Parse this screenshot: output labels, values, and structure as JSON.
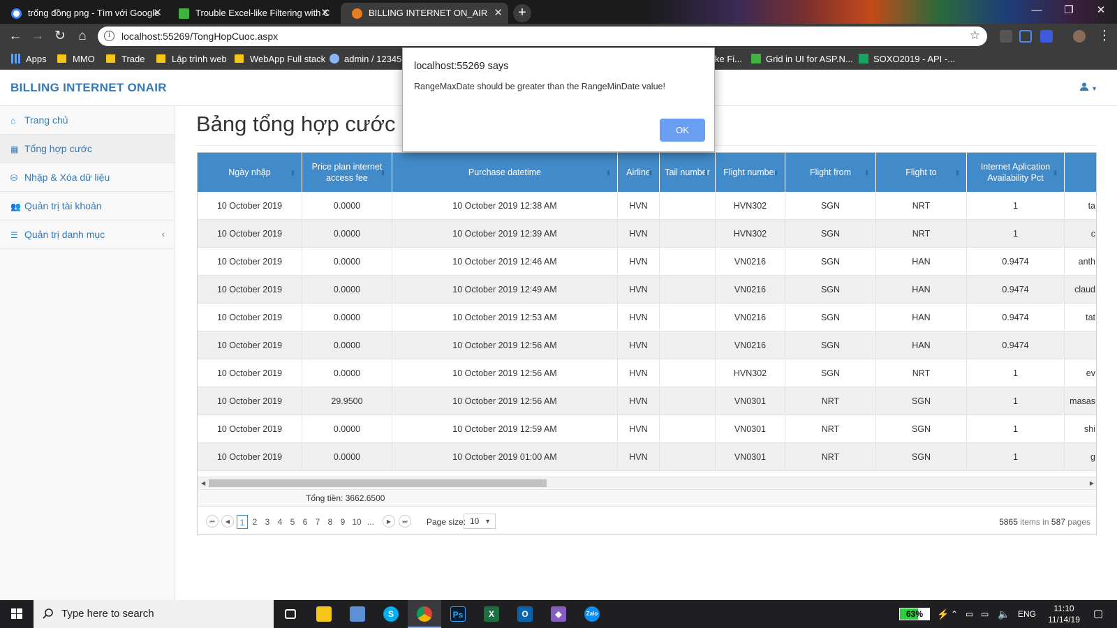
{
  "browser": {
    "tabs": [
      {
        "title": "trống đồng png - Tìm với Google",
        "active": false
      },
      {
        "title": "Trouble Excel-like Filtering with C",
        "active": false
      },
      {
        "title": "BILLING INTERNET ON_AIR",
        "active": true
      }
    ],
    "new_tab": "+",
    "window_controls": {
      "minimize": "—",
      "maximize": "❐",
      "close": "✕"
    },
    "url": "localhost:55269/TongHopCuoc.aspx",
    "bookmarks": [
      "Apps",
      "MMO",
      "Trade",
      "Lập trình web",
      "WebApp Full stack",
      "admin / 12345",
      "ke Fi...",
      "Grid in UI for ASP.N...",
      "SOXO2019 - API -..."
    ]
  },
  "app": {
    "brand": "BILLING INTERNET ONAIR",
    "user_icon": "user-icon",
    "sidebar": [
      {
        "label": "Trang chủ",
        "icon": "home-icon",
        "active": false
      },
      {
        "label": "Tổng hợp cước",
        "icon": "grid-icon",
        "active": true
      },
      {
        "label": "Nhập & Xóa dữ liệu",
        "icon": "database-icon",
        "active": false
      },
      {
        "label": "Quản trị tài khoản",
        "icon": "users-icon",
        "active": false
      },
      {
        "label": "Quản trị danh mục",
        "icon": "list-icon",
        "active": false
      }
    ],
    "page_title": "Bảng tổng hợp cước",
    "grid": {
      "columns": [
        "Ngày nhập",
        "Price plan internet access fee",
        "Purchase datetime",
        "Airline",
        "Tail number",
        "Flight number",
        "Flight from",
        "Flight to",
        "Internet Aplication Availability Pct",
        ""
      ],
      "rows": [
        [
          "10 October 2019",
          "0.0000",
          "10 October 2019 12:38 AM",
          "HVN",
          "",
          "HVN302",
          "SGN",
          "NRT",
          "1",
          "ta"
        ],
        [
          "10 October 2019",
          "0.0000",
          "10 October 2019 12:39 AM",
          "HVN",
          "",
          "HVN302",
          "SGN",
          "NRT",
          "1",
          "c"
        ],
        [
          "10 October 2019",
          "0.0000",
          "10 October 2019 12:46 AM",
          "HVN",
          "",
          "VN0216",
          "SGN",
          "HAN",
          "0.9474",
          "anth"
        ],
        [
          "10 October 2019",
          "0.0000",
          "10 October 2019 12:49 AM",
          "HVN",
          "",
          "VN0216",
          "SGN",
          "HAN",
          "0.9474",
          "claud"
        ],
        [
          "10 October 2019",
          "0.0000",
          "10 October 2019 12:53 AM",
          "HVN",
          "",
          "VN0216",
          "SGN",
          "HAN",
          "0.9474",
          "tat"
        ],
        [
          "10 October 2019",
          "0.0000",
          "10 October 2019 12:56 AM",
          "HVN",
          "",
          "VN0216",
          "SGN",
          "HAN",
          "0.9474",
          ""
        ],
        [
          "10 October 2019",
          "0.0000",
          "10 October 2019 12:56 AM",
          "HVN",
          "",
          "HVN302",
          "SGN",
          "NRT",
          "1",
          "ev"
        ],
        [
          "10 October 2019",
          "29.9500",
          "10 October 2019 12:56 AM",
          "HVN",
          "",
          "VN0301",
          "NRT",
          "SGN",
          "1",
          "masas"
        ],
        [
          "10 October 2019",
          "0.0000",
          "10 October 2019 12:59 AM",
          "HVN",
          "",
          "VN0301",
          "NRT",
          "SGN",
          "1",
          "shi"
        ],
        [
          "10 October 2019",
          "0.0000",
          "10 October 2019 01:00 AM",
          "HVN",
          "",
          "VN0301",
          "NRT",
          "SGN",
          "1",
          "g"
        ]
      ],
      "total": "Tổng tiền: 3662.6500",
      "pager": {
        "pages": [
          "1",
          "2",
          "3",
          "4",
          "5",
          "6",
          "7",
          "8",
          "9",
          "10",
          "..."
        ],
        "current": "1",
        "page_size_label": "Page size:",
        "page_size": "10",
        "items_total": "5865",
        "items_label": "items in",
        "pages_total": "587",
        "pages_label": "pages"
      }
    }
  },
  "dialog": {
    "title": "localhost:55269 says",
    "message": "RangeMaxDate should be greater than the RangeMinDate value!",
    "ok": "OK"
  },
  "taskbar": {
    "search_placeholder": "Type here to search",
    "battery": "63%",
    "battery_level": 0.63,
    "language": "ENG",
    "time": "11:10",
    "date": "11/14/19"
  },
  "colors": {
    "brand": "#337ab7",
    "grid_header": "#428bca",
    "ok_button": "#6a9ef2"
  }
}
